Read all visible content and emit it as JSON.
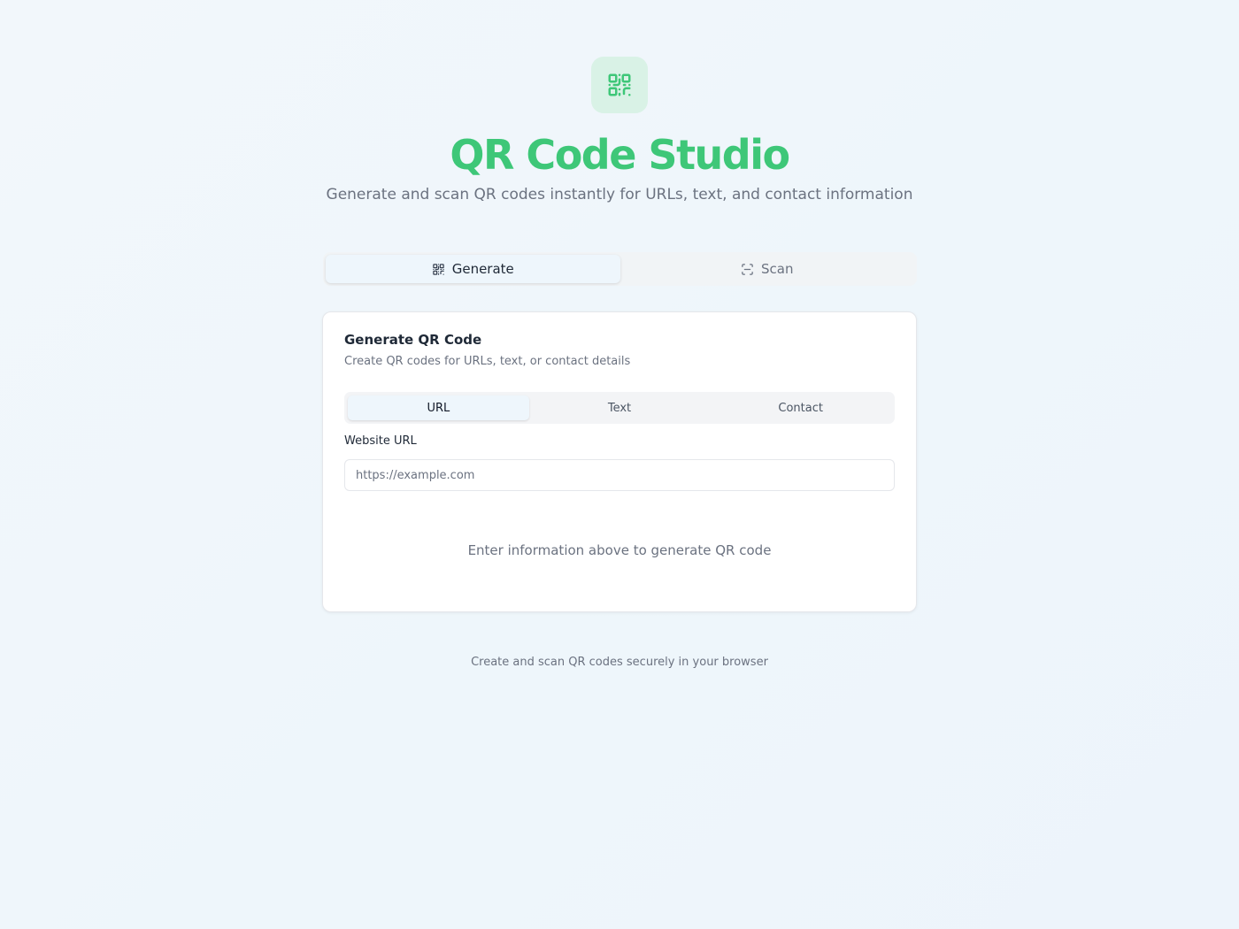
{
  "header": {
    "logo_icon": "qr-code-icon",
    "title": "QR Code Studio",
    "subtitle": "Generate and scan QR codes instantly for URLs, text, and contact information"
  },
  "main_tabs": [
    {
      "label": "Generate",
      "icon": "qr-code-icon",
      "active": true
    },
    {
      "label": "Scan",
      "icon": "scan-icon",
      "active": false
    }
  ],
  "card": {
    "title": "Generate QR Code",
    "description": "Create QR codes for URLs, text, or contact details",
    "sub_tabs": [
      {
        "label": "URL",
        "active": true
      },
      {
        "label": "Text",
        "active": false
      },
      {
        "label": "Contact",
        "active": false
      }
    ],
    "field_label": "Website URL",
    "input_value": "",
    "input_placeholder": "https://example.com",
    "empty_state": "Enter information above to generate QR code"
  },
  "footer": {
    "text": "Create and scan QR codes securely in your browser"
  },
  "colors": {
    "accent": "#3ec778",
    "logo_bg": "#d9f2e6"
  }
}
